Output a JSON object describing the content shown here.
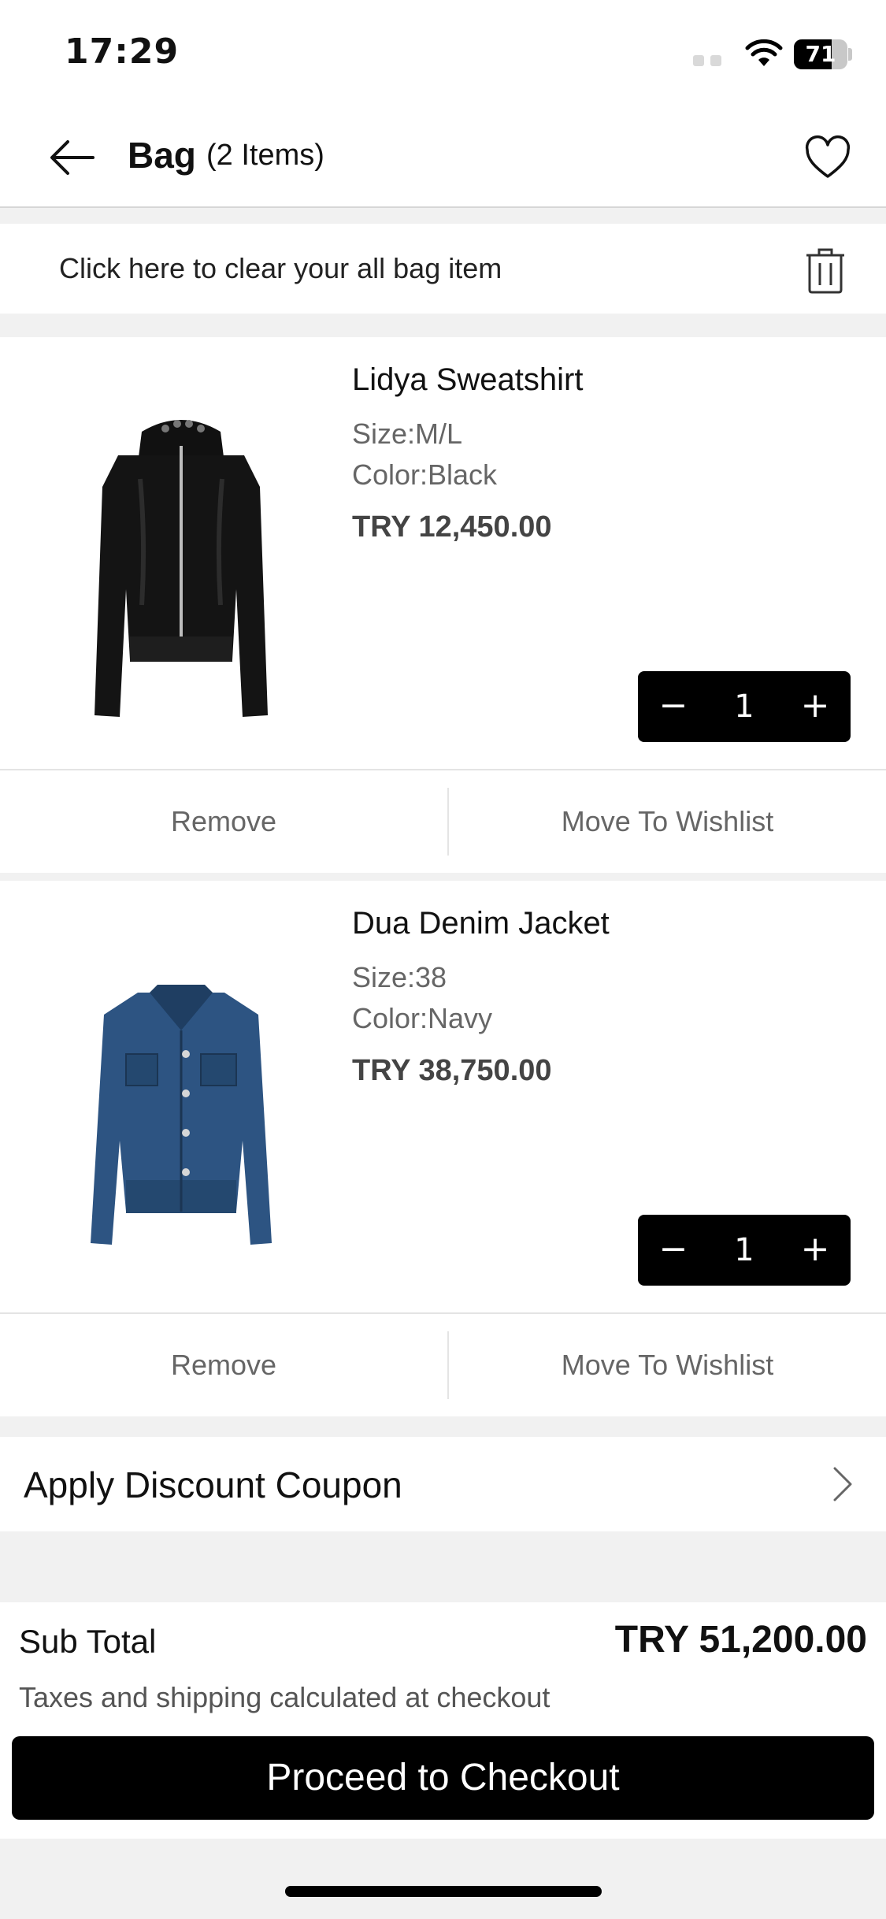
{
  "status_bar": {
    "time": "17:29",
    "battery": "71"
  },
  "header": {
    "title": "Bag",
    "item_count": "(2 Items)"
  },
  "clear_bar": {
    "text": "Click here to clear your all bag item"
  },
  "items": [
    {
      "name": "Lidya Sweatshirt",
      "size": "Size:M/L",
      "color": "Color:Black",
      "price": "TRY 12,450.00",
      "quantity": "1",
      "remove_label": "Remove",
      "wishlist_label": "Move To Wishlist"
    },
    {
      "name": "Dua Denim Jacket",
      "size": "Size:38",
      "color": "Color:Navy",
      "price": "TRY 38,750.00",
      "quantity": "1",
      "remove_label": "Remove",
      "wishlist_label": "Move To Wishlist"
    }
  ],
  "stepper": {
    "minus": "−",
    "plus": "+"
  },
  "coupon": {
    "label": "Apply Discount Coupon"
  },
  "summary": {
    "subtotal_label": "Sub Total",
    "subtotal_value": "TRY 51,200.00",
    "tax_note": "Taxes and shipping calculated at checkout",
    "checkout_label": "Proceed to Checkout"
  },
  "colors": {
    "accent": "#000000",
    "background": "#f1f1f1",
    "muted_text": "#666666"
  }
}
